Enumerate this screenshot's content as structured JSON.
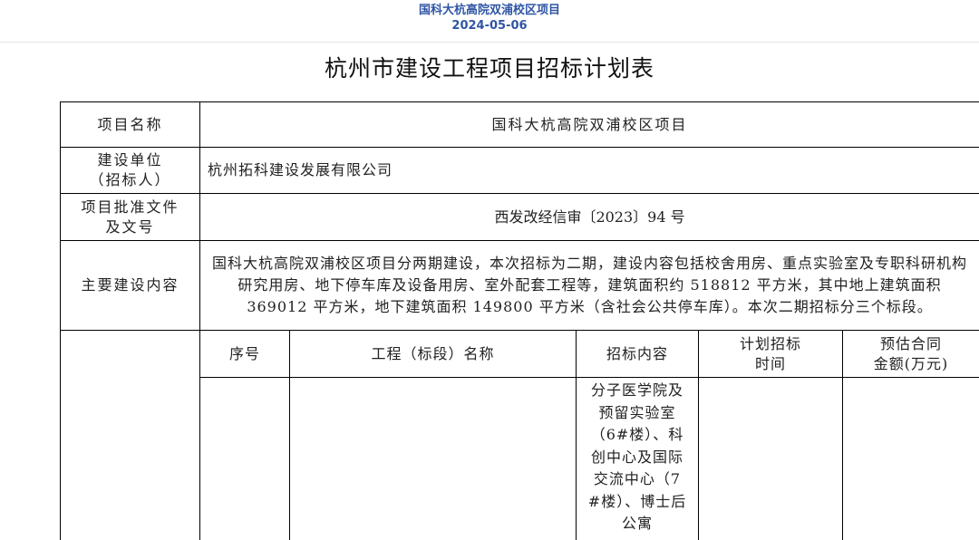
{
  "header": {
    "project": "国科大杭高院双浦校区项目",
    "date": "2024-05-06"
  },
  "document": {
    "title": "杭州市建设工程项目招标计划表"
  },
  "table": {
    "project_name_label": "项目名称",
    "project_name_value": "国科大杭高院双浦校区项目",
    "builder_label_line1": "建设单位",
    "builder_label_line2": "（招标人）",
    "builder_value": "杭州拓科建设发展有限公司",
    "approval_label_line1": "项目批准文件",
    "approval_label_line2": "及文号",
    "approval_value": "西发改经信审〔2023〕94 号",
    "content_label": "主要建设内容",
    "content_value": "国科大杭高院双浦校区项目分两期建设，本次招标为二期，建设内容包括校舍用房、重点实验室及专职科研机构研究用房、地下停车库及设备用房、室外配套工程等，建筑面积约 518812 平方米，其中地上建筑面积 369012 平方米，地下建筑面积 149800 平方米（含社会公共停车库）。本次二期招标分三个标段。",
    "columns": {
      "seq": "序号",
      "name": "工程（标段）名称",
      "scope": "招标内容",
      "time_line1": "计划招标",
      "time_line2": "时间",
      "amount_line1": "预估合同",
      "amount_line2": "金额(万元)"
    },
    "rows": [
      {
        "seq": "",
        "name": "",
        "scope": "分子医学院及预留实验室（6#楼）、科创中心及国际交流中心（7#楼）、博士后公寓",
        "time": "",
        "amount": ""
      }
    ]
  }
}
